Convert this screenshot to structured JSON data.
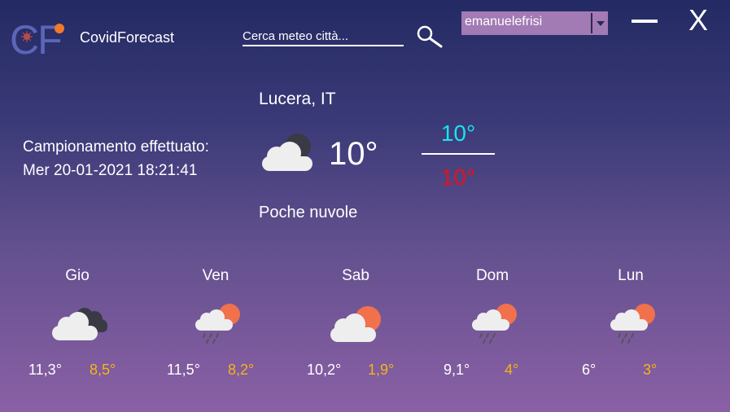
{
  "app": {
    "logo_letters": "CF",
    "title": "CovidForecast"
  },
  "search": {
    "placeholder": "Cerca meteo città..."
  },
  "user": {
    "selected": "emanuelefrisi"
  },
  "window_controls": {
    "close_label": "X"
  },
  "current": {
    "sample_label": "Campionamento effettuato:",
    "sample_date": "Mer 20-01-2021 18:21:41",
    "city": "Lucera, IT",
    "temp": "10°",
    "max": "10°",
    "min": "10°",
    "description": "Poche nuvole",
    "icon": "broken-clouds-icon"
  },
  "forecast": [
    {
      "day": "Gio",
      "hi": "11,3°",
      "lo": "8,5°",
      "icon": "broken-clouds-icon"
    },
    {
      "day": "Ven",
      "hi": "11,5°",
      "lo": "8,2°",
      "icon": "rain-sun-icon"
    },
    {
      "day": "Sab",
      "hi": "10,2°",
      "lo": "1,9°",
      "icon": "partly-cloudy-icon"
    },
    {
      "day": "Dom",
      "hi": "9,1°",
      "lo": "4°",
      "icon": "rain-sun-icon"
    },
    {
      "day": "Lun",
      "hi": "6°",
      "lo": "3°",
      "icon": "rain-sun-icon"
    }
  ],
  "colors": {
    "max_temp": "#17e3f0",
    "min_temp": "#e3121c",
    "forecast_low": "#f5b418",
    "select_bg": "#a27ab4"
  }
}
